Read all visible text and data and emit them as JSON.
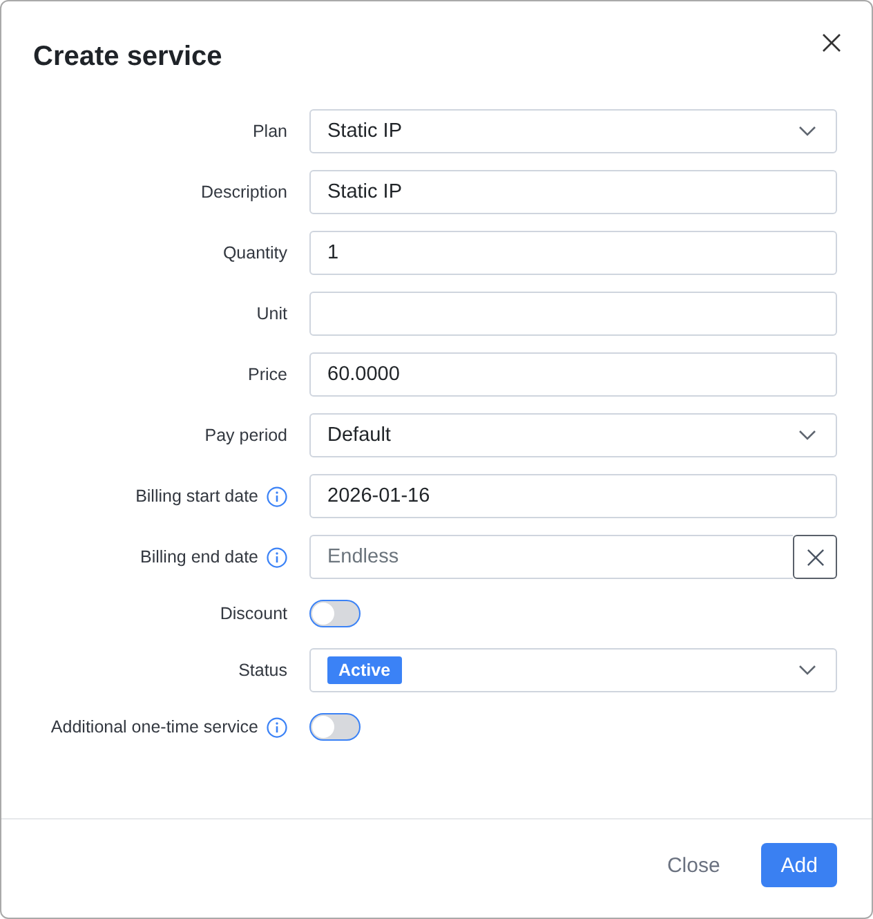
{
  "dialog": {
    "title": "Create service"
  },
  "fields": [
    {
      "kind": "select",
      "label": "Plan",
      "value": "Static IP"
    },
    {
      "kind": "input",
      "label": "Description",
      "value": "Static IP"
    },
    {
      "kind": "input",
      "label": "Quantity",
      "value": "1"
    },
    {
      "kind": "input",
      "label": "Unit"
    },
    {
      "kind": "input",
      "label": "Price",
      "value": "60.0000"
    },
    {
      "kind": "select",
      "label": "Pay period",
      "value": "Default"
    },
    {
      "kind": "input",
      "label": "Billing start date",
      "info": true,
      "value": "2026-01-16"
    },
    {
      "kind": "clearable",
      "label": "Billing end date",
      "info": true,
      "placeholder": "Endless"
    },
    {
      "kind": "toggle",
      "label": "Discount",
      "on": false
    },
    {
      "kind": "badge-select",
      "label": "Status",
      "value": "Active"
    },
    {
      "kind": "toggle",
      "label": "Additional one-time service",
      "info": true,
      "on": false
    }
  ],
  "buttons": [
    {
      "label": "Close",
      "kind": "secondary"
    },
    {
      "label": "Add",
      "kind": "primary"
    }
  ]
}
